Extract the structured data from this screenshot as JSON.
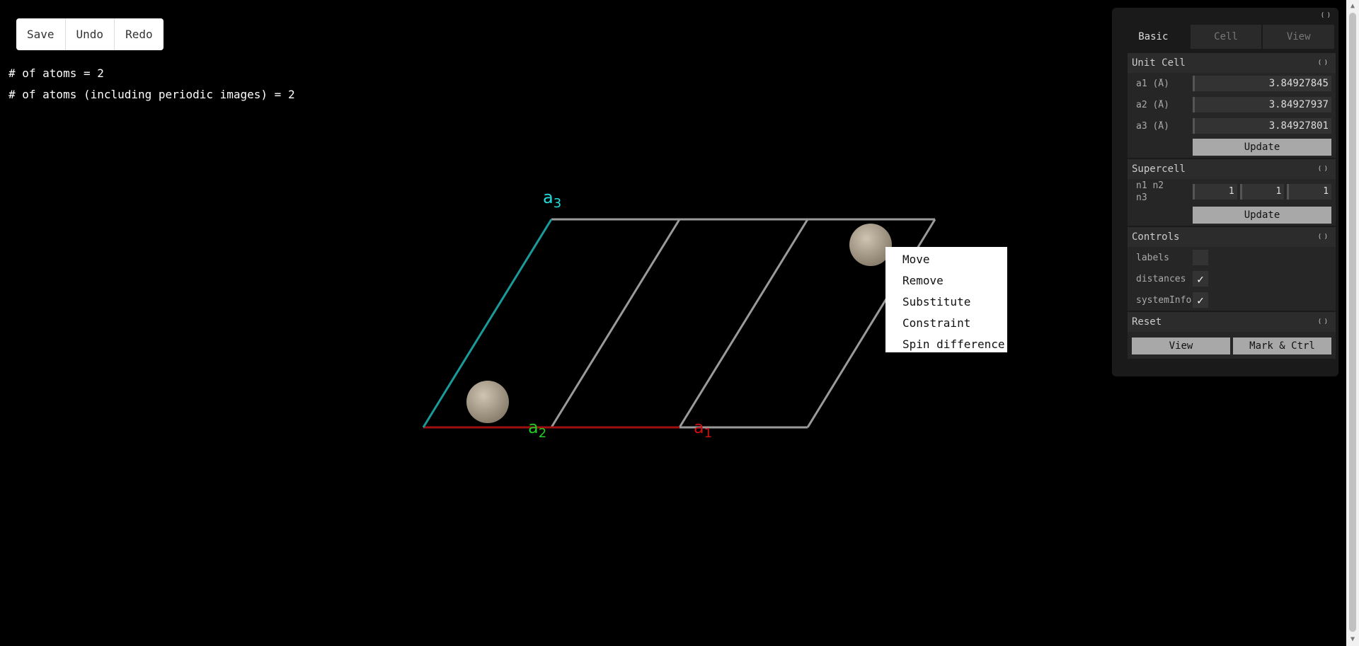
{
  "toolbar": {
    "save": "Save",
    "undo": "Undo",
    "redo": "Redo"
  },
  "info": {
    "atoms_line": "# of atoms = 2",
    "atoms_periodic_line": "# of atoms (including periodic images) = 2"
  },
  "axes": {
    "a1": {
      "letter": "a",
      "sub": "1",
      "color": "#cc1010"
    },
    "a2": {
      "letter": "a",
      "sub": "2",
      "color": "#22cc22"
    },
    "a3": {
      "letter": "a",
      "sub": "3",
      "color": "#22dddd"
    }
  },
  "scene_colors": {
    "cell_edge": "#9a9a9a",
    "a1_axis": "#a01010",
    "a3_axis": "#1a9a9a",
    "atom": "#a89c8a"
  },
  "context_menu": {
    "items": [
      "Move",
      "Remove",
      "Substitute",
      "Constraint",
      "Spin difference"
    ]
  },
  "panel": {
    "tabs": [
      "Basic",
      "Cell",
      "View"
    ],
    "active_tab": "Basic",
    "unit_cell": {
      "title": "Unit Cell",
      "rows": [
        {
          "label": "a1 (Å)",
          "value": "3.84927845"
        },
        {
          "label": "a2 (Å)",
          "value": "3.84927937"
        },
        {
          "label": "a3 (Å)",
          "value": "3.84927801"
        }
      ],
      "update": "Update"
    },
    "supercell": {
      "title": "Supercell",
      "label_line1": "n1 n2",
      "label_line2": "n3",
      "values": [
        "1",
        "1",
        "1"
      ],
      "update": "Update"
    },
    "controls": {
      "title": "Controls",
      "labels": {
        "label": "labels",
        "checked": false
      },
      "distances": {
        "label": "distances",
        "checked": true
      },
      "systemInfo": {
        "label": "systemInfo",
        "checked": true
      }
    },
    "reset": {
      "title": "Reset",
      "view": "View",
      "mark_ctrl": "Mark & Ctrl"
    }
  }
}
